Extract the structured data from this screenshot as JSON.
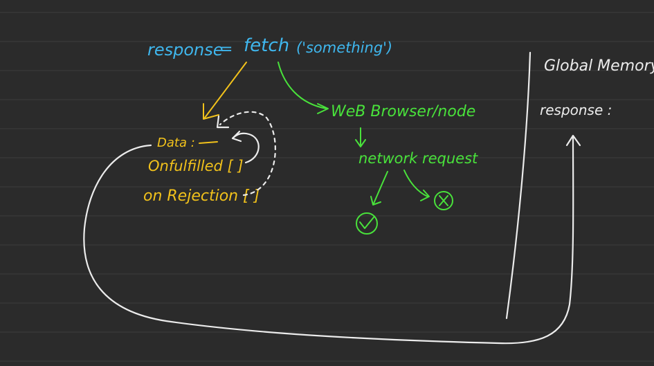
{
  "board": {
    "expression": {
      "lhs": "response",
      "op": "=",
      "call": "fetch",
      "args": "('something')"
    },
    "env": {
      "label": "WeB Browser/node",
      "request": "network request",
      "success_symbol": "✓",
      "failure_symbol": "×"
    },
    "promise": {
      "data": "Data :",
      "onfulfilled": "Onfulfilled [ ]",
      "onrejection": "on Rejection [ ]"
    },
    "memory": {
      "title": "Global Memory",
      "response": "response :"
    },
    "colors": {
      "background": "#2b2b2b",
      "white": "#ececec",
      "cyan": "#3fb7ee",
      "yellow": "#f2c21b",
      "green": "#49e23b"
    }
  }
}
